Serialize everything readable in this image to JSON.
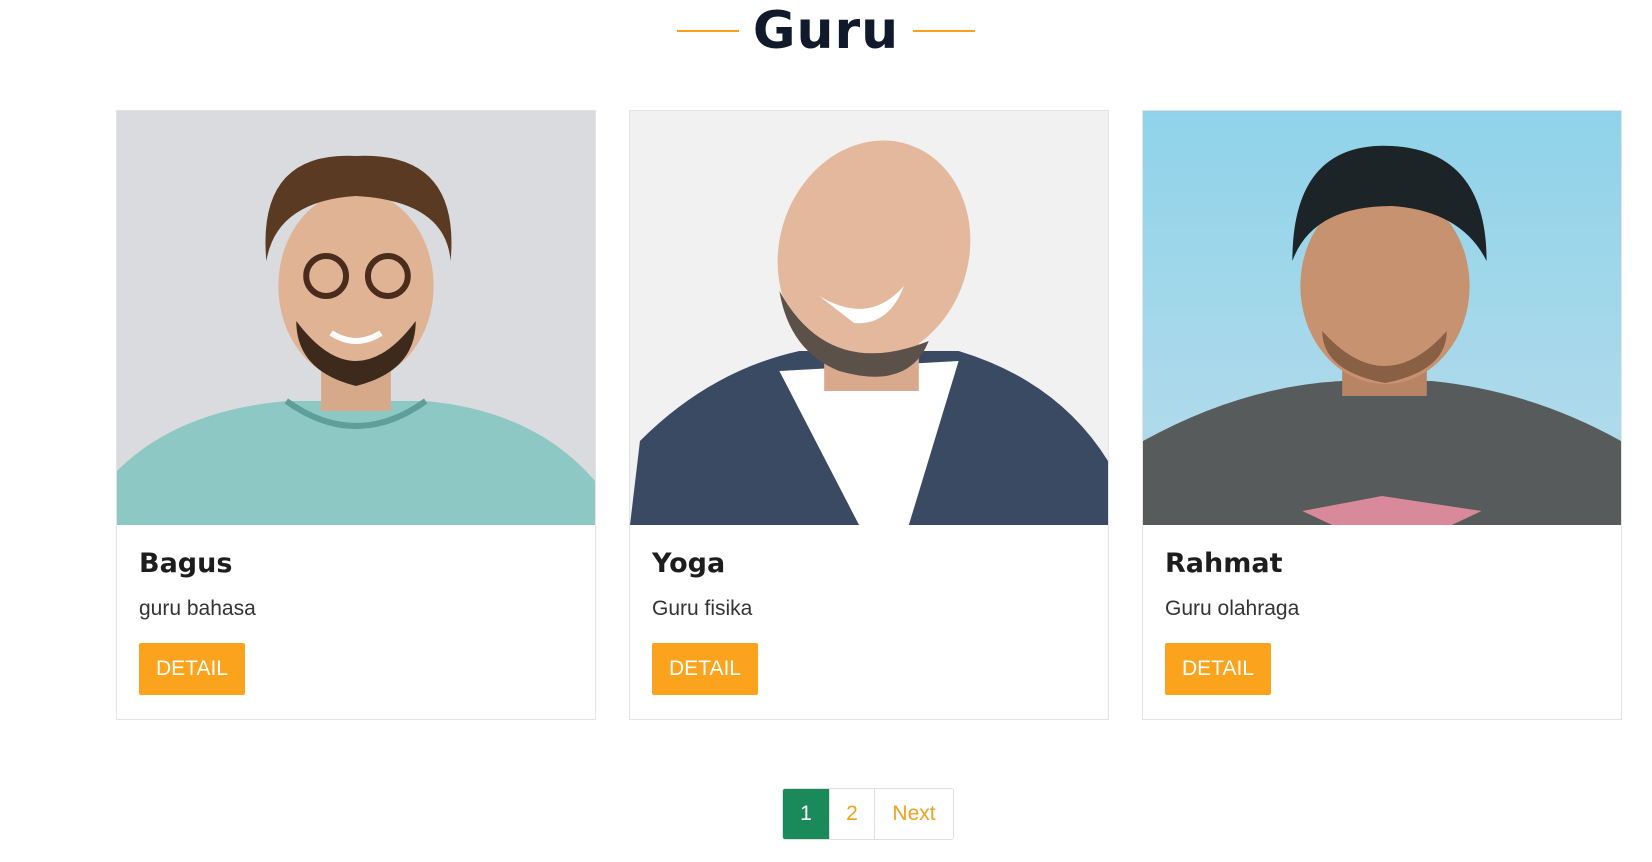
{
  "section": {
    "title": "Guru"
  },
  "teachers": [
    {
      "name": "Bagus",
      "role": "guru bahasa",
      "button_label": "DETAIL"
    },
    {
      "name": "Yoga",
      "role": "Guru fisika",
      "button_label": "DETAIL"
    },
    {
      "name": "Rahmat",
      "role": "Guru olahraga",
      "button_label": "DETAIL"
    }
  ],
  "pagination": {
    "pages": [
      "1",
      "2"
    ],
    "active": "1",
    "next_label": "Next"
  },
  "colors": {
    "accent": "#fba31c",
    "active_page": "#1b8a5a",
    "title": "#111a2b"
  }
}
